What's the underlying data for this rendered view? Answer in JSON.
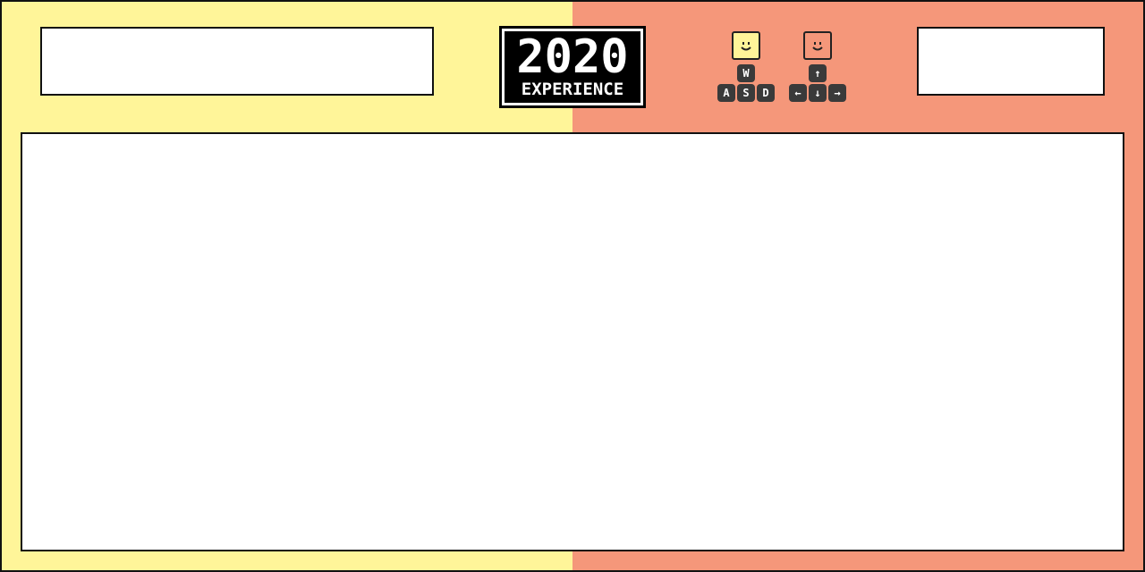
{
  "colors": {
    "left_background": "#fff599",
    "right_background": "#f5977a",
    "player1_face": "#fff599",
    "player2_face": "#f5977a",
    "panel_fill": "#ffffff",
    "outline": "#111111",
    "key_fill": "#3a3a3a"
  },
  "logo": {
    "year": "2020",
    "word": "EXPERIENCE"
  },
  "players": [
    {
      "face_icon": "smiley-face-icon",
      "keys": {
        "up": "W",
        "left": "A",
        "down": "S",
        "right": "D"
      }
    },
    {
      "face_icon": "smiley-face-icon",
      "keys": {
        "up": "↑",
        "left": "←",
        "down": "↓",
        "right": "→"
      }
    }
  ]
}
